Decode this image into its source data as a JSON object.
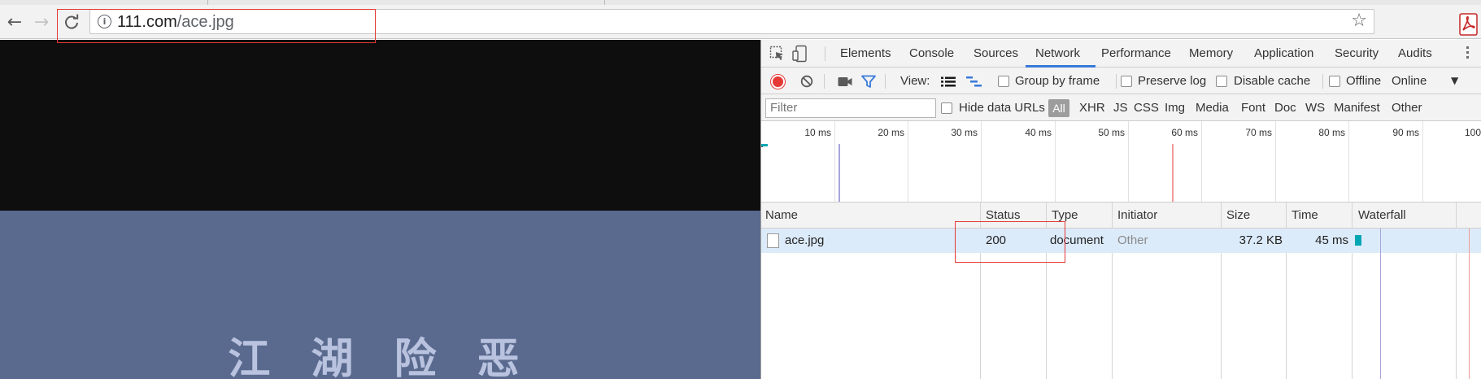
{
  "browser": {
    "url_host": "111.com",
    "url_path": "/ace.jpg"
  },
  "page": {
    "image_text": "江 湖 险 恶"
  },
  "devtools": {
    "tabs": [
      "Elements",
      "Console",
      "Sources",
      "Network",
      "Performance",
      "Memory",
      "Application",
      "Security",
      "Audits"
    ],
    "active_tab": "Network",
    "toolbar": {
      "view_label": "View:",
      "group_by_frame": "Group by frame",
      "preserve_log": "Preserve log",
      "disable_cache": "Disable cache",
      "offline": "Offline",
      "throttle": "Online"
    },
    "filter": {
      "placeholder": "Filter",
      "hide_data_urls": "Hide data URLs",
      "types": [
        "All",
        "XHR",
        "JS",
        "CSS",
        "Img",
        "Media",
        "Font",
        "Doc",
        "WS",
        "Manifest",
        "Other"
      ]
    },
    "overview_ticks": [
      "10 ms",
      "20 ms",
      "30 ms",
      "40 ms",
      "50 ms",
      "60 ms",
      "70 ms",
      "80 ms",
      "90 ms",
      "100"
    ],
    "columns": [
      "Name",
      "Status",
      "Type",
      "Initiator",
      "Size",
      "Time",
      "Waterfall"
    ],
    "rows": [
      {
        "name": "ace.jpg",
        "status": "200",
        "type": "document",
        "initiator": "Other",
        "size": "37.2 KB",
        "time": "45 ms"
      }
    ]
  },
  "colors": {
    "accent": "#3879d9",
    "record": "#e53935",
    "annotation": "#e53935",
    "waterfall_bar": "#00a6b4"
  }
}
